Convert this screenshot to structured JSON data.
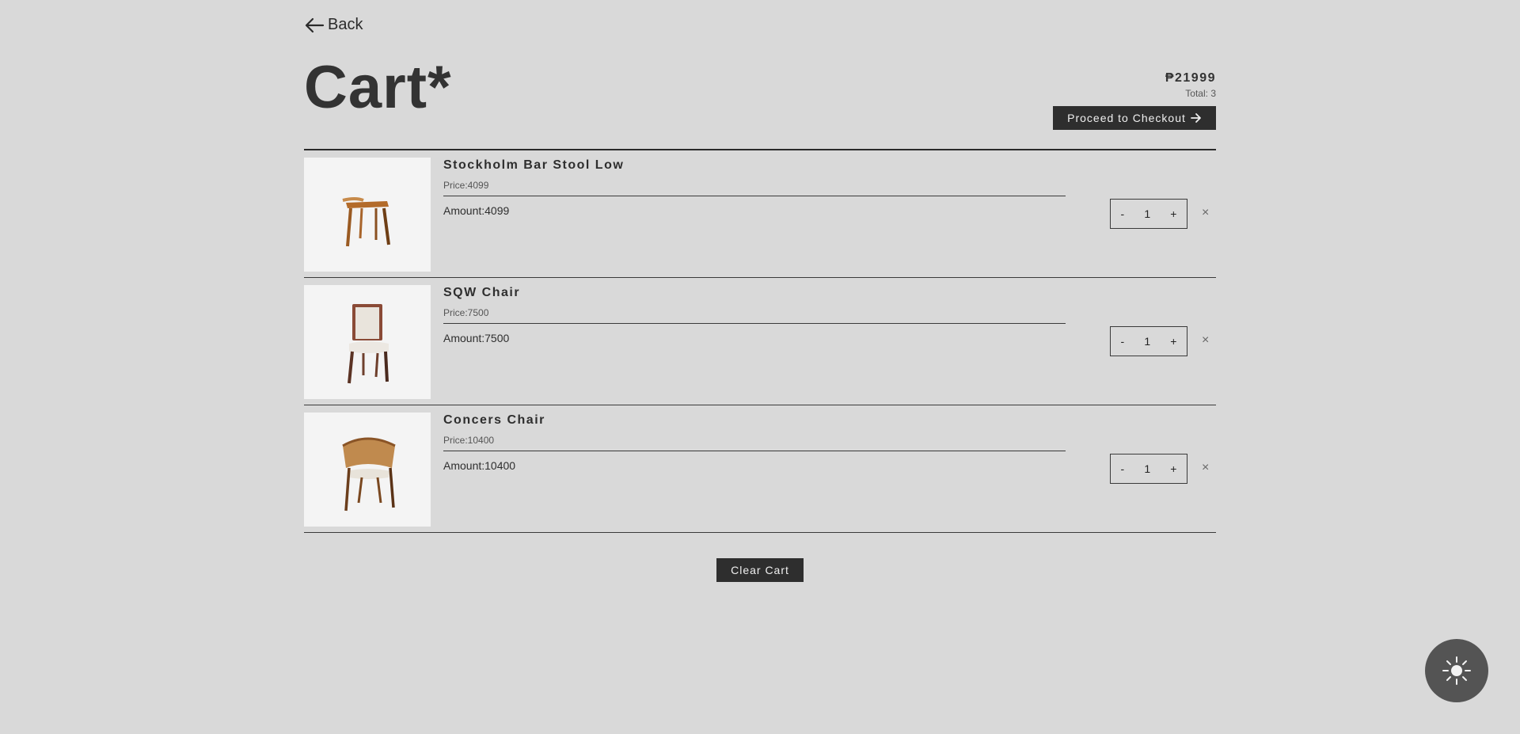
{
  "nav": {
    "back_label": "Back"
  },
  "page": {
    "title": "Cart*"
  },
  "summary": {
    "price": "₱21999",
    "total": "Total: 3"
  },
  "actions": {
    "checkout_label": "Proceed to Checkout",
    "clear_label": "Clear Cart"
  },
  "items": [
    {
      "name": "Stockholm Bar Stool Low",
      "price": "Price:4099",
      "amount": "Amount:4099",
      "qty": "1",
      "image_icon": "bar-stool-image"
    },
    {
      "name": "SQW Chair",
      "price": "Price:7500",
      "amount": "Amount:7500",
      "qty": "1",
      "image_icon": "upholstered-chair-image"
    },
    {
      "name": "Concers Chair",
      "price": "Price:10400",
      "amount": "Amount:10400",
      "qty": "1",
      "image_icon": "cane-armchair-image"
    }
  ],
  "stepper": {
    "minus": "-",
    "plus": "+"
  },
  "remove_symbol": "×",
  "colors": {
    "background": "#d9d9d9",
    "button": "#2e2e2e",
    "toggle": "#545454"
  }
}
